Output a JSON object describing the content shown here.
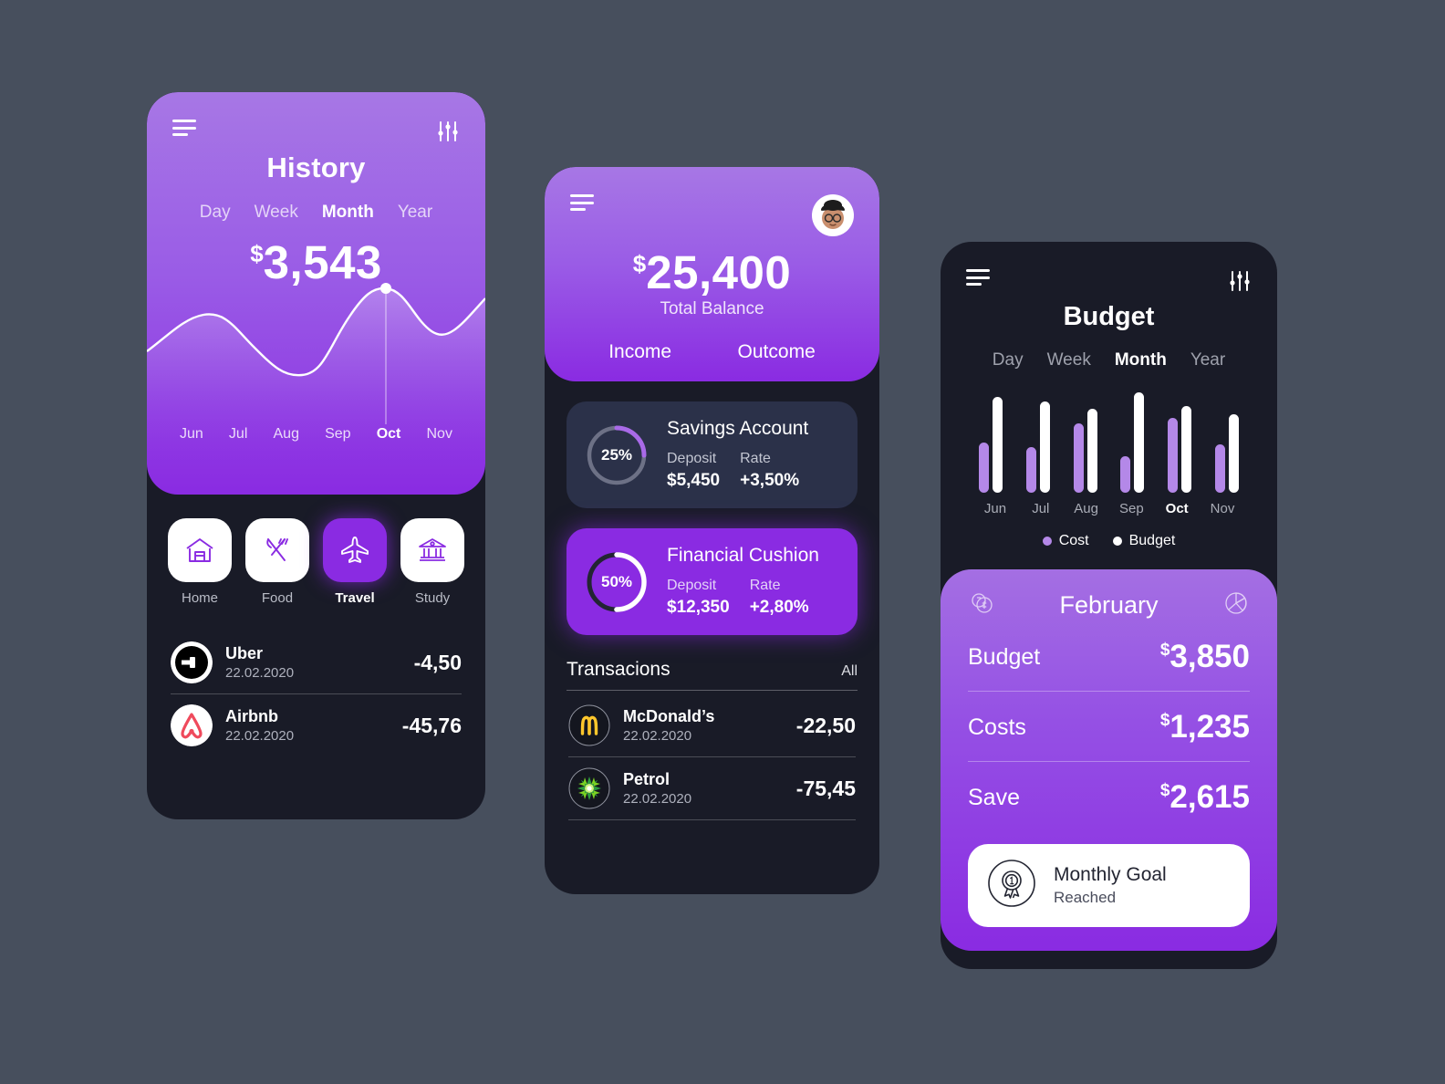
{
  "theme": {
    "page_bg": "#474f5d",
    "phone_bg": "#191b27",
    "purple_light": "#a777e5",
    "purple_dark": "#8a2be2",
    "card_dark": "#2b3149",
    "cost_color": "#b488e8",
    "budget_color": "#ffffff"
  },
  "history": {
    "title": "History",
    "tabs": [
      {
        "label": "Day",
        "active": false
      },
      {
        "label": "Week",
        "active": false
      },
      {
        "label": "Month",
        "active": true
      },
      {
        "label": "Year",
        "active": false
      }
    ],
    "currency": "$",
    "amount": "3,543",
    "categories": [
      {
        "label": "Home",
        "icon": "house-icon",
        "selected": false
      },
      {
        "label": "Food",
        "icon": "fork-knife-icon",
        "selected": false
      },
      {
        "label": "Travel",
        "icon": "airplane-icon",
        "selected": true
      },
      {
        "label": "Study",
        "icon": "bank-building-icon",
        "selected": false
      }
    ],
    "transactions": [
      {
        "name": "Uber",
        "date": "22.02.2020",
        "amount": "-4,50",
        "logo": "uber-logo"
      },
      {
        "name": "Airbnb",
        "date": "22.02.2020",
        "amount": "-45,76",
        "logo": "airbnb-logo"
      }
    ]
  },
  "wallet": {
    "currency": "$",
    "balance": "25,400",
    "balance_label": "Total Balance",
    "income_label": "Income",
    "outcome_label": "Outcome",
    "accounts": [
      {
        "name": "Savings Account",
        "percent": "25%",
        "percent_value": 25,
        "deposit_label": "Deposit",
        "deposit_value": "$5,450",
        "rate_label": "Rate",
        "rate_value": "+3,50%",
        "style": "dark"
      },
      {
        "name": "Financial Cushion",
        "percent": "50%",
        "percent_value": 50,
        "deposit_label": "Deposit",
        "deposit_value": "$12,350",
        "rate_label": "Rate",
        "rate_value": "+2,80%",
        "style": "violet"
      }
    ],
    "transactions_title": "Transacions",
    "transactions_all": "All",
    "transactions": [
      {
        "name": "McDonald’s",
        "date": "22.02.2020",
        "amount": "-22,50",
        "logo": "mcdonalds-logo"
      },
      {
        "name": "Petrol",
        "date": "22.02.2020",
        "amount": "-75,45",
        "logo": "bp-logo"
      }
    ]
  },
  "budget": {
    "title": "Budget",
    "tabs": [
      {
        "label": "Day",
        "active": false
      },
      {
        "label": "Week",
        "active": false
      },
      {
        "label": "Month",
        "active": true
      },
      {
        "label": "Year",
        "active": false
      }
    ],
    "legend": [
      {
        "label": "Cost",
        "color": "#b488e8"
      },
      {
        "label": "Budget",
        "color": "#ffffff"
      }
    ],
    "card": {
      "month": "February",
      "left_icon": "coins-icon",
      "right_icon": "pie-chart-icon",
      "rows": [
        {
          "key": "Budget",
          "currency": "$",
          "value": "3,850"
        },
        {
          "key": "Costs",
          "currency": "$",
          "value": "1,235"
        },
        {
          "key": "Save",
          "currency": "$",
          "value": "2,615"
        }
      ],
      "goal": {
        "title": "Monthly Goal",
        "status": "Reached",
        "icon": "medal-icon"
      }
    }
  },
  "chart_data": [
    {
      "type": "area",
      "title": "History spending",
      "x": [
        "Jun",
        "Jul",
        "Aug",
        "Sep",
        "Oct",
        "Nov"
      ],
      "values": [
        62,
        78,
        48,
        40,
        95,
        72
      ],
      "highlight": "Oct",
      "highlight_value": 95,
      "ylim": [
        0,
        100
      ],
      "grid": false,
      "legend": "none",
      "xlabel": "",
      "ylabel": ""
    },
    {
      "type": "bar",
      "title": "Budget vs Cost",
      "categories": [
        "Jun",
        "Jul",
        "Aug",
        "Sep",
        "Oct",
        "Nov"
      ],
      "series": [
        {
          "name": "Cost",
          "values": [
            52,
            48,
            72,
            38,
            78,
            50
          ],
          "color": "#b488e8"
        },
        {
          "name": "Budget",
          "values": [
            100,
            95,
            88,
            105,
            90,
            82
          ],
          "color": "#ffffff"
        }
      ],
      "highlight": "Oct",
      "ylim": [
        0,
        110
      ],
      "grid": false,
      "legend": "bottom",
      "xlabel": "",
      "ylabel": ""
    }
  ]
}
